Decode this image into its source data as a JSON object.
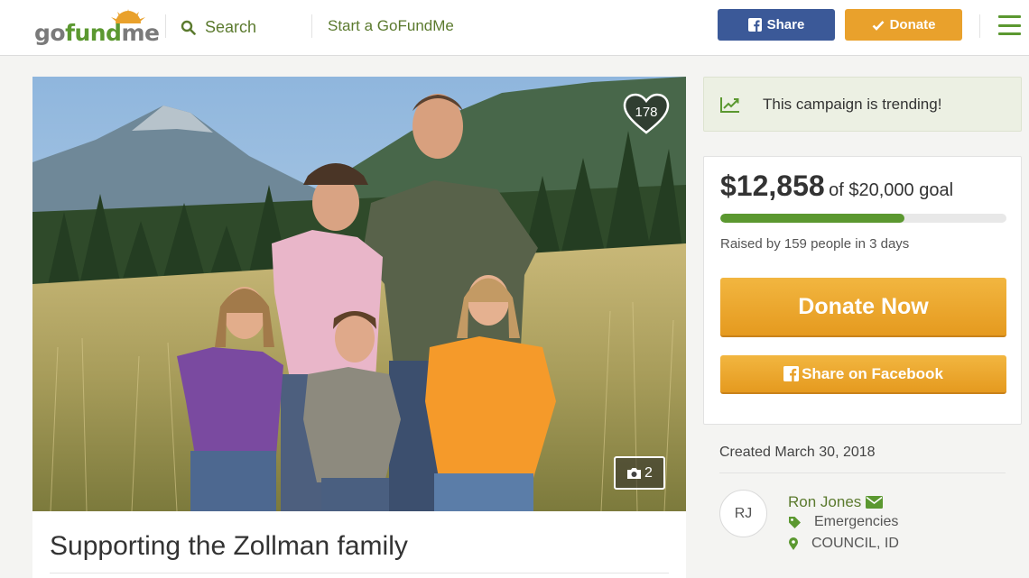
{
  "header": {
    "logo": {
      "part1": "go",
      "part2": "fund",
      "part3": "me"
    },
    "search_label": "Search",
    "start_link": "Start a GoFundMe",
    "share_label": "Share",
    "donate_label": "Donate"
  },
  "hero": {
    "heart_count": "178",
    "photo_count": "2"
  },
  "campaign": {
    "title": "Supporting the Zollman family",
    "trending_text": "This campaign is trending!",
    "raised_amount": "$12,858",
    "goal_text": "of $20,000 goal",
    "progress_fraction": 0.643,
    "raised_by": "Raised by 159 people in 3 days",
    "donate_now_label": "Donate Now",
    "share_facebook_label": "Share on Facebook",
    "created": "Created March 30, 2018"
  },
  "organizer": {
    "initials": "RJ",
    "name": "Ron Jones",
    "category": "Emergencies",
    "location": "COUNCIL, ID"
  },
  "colors": {
    "brand_green": "#5b9830",
    "facebook_blue": "#3b5998",
    "donate_orange": "#e9a12c"
  },
  "icons": [
    "search-icon",
    "facebook-icon",
    "check-icon",
    "hamburger-menu-icon",
    "heart-icon",
    "camera-icon",
    "trending-chart-icon",
    "envelope-icon",
    "tag-icon",
    "map-pin-icon"
  ]
}
